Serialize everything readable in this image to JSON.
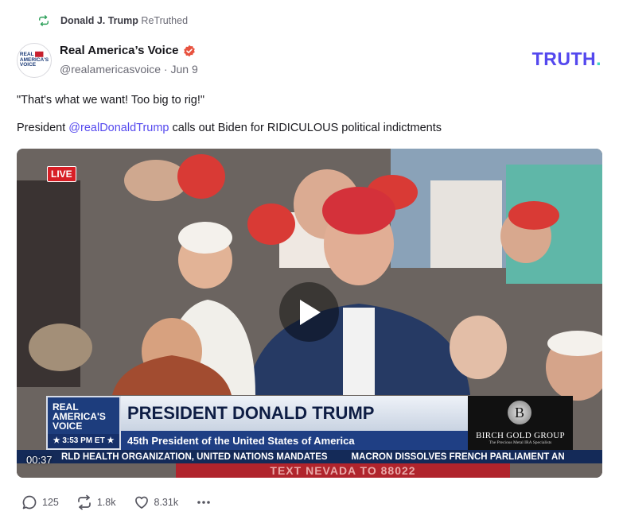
{
  "retruth": {
    "user": "Donald J. Trump",
    "label": "ReTruthed"
  },
  "author": {
    "name": "Real America’s Voice",
    "handle": "@realamericasvoice",
    "date": "Jun 9"
  },
  "brand": {
    "logo_main": "TRUTH",
    "logo_dot": "."
  },
  "post": {
    "line1": "\"That's what we want! Too big to rig!\"",
    "line2_prefix": "President ",
    "mention": "@realDonaldTrump",
    "line2_suffix": " calls out Biden for RIDICULOUS political indictments"
  },
  "video": {
    "live_badge": "LIVE",
    "duration": "00:37",
    "lower_third": {
      "channel": "REAL AMERICA'S VOICE",
      "time": "★ 3:53 PM ET ★",
      "headline": "PRESIDENT DONALD TRUMP",
      "subline": "45th President of the United States of America",
      "sponsor": "BIRCH GOLD GROUP",
      "sponsor_tag": "The Precious Metal IRA Specialists"
    },
    "ticker": [
      "RLD HEALTH ORGANIZATION, UNITED NATIONS MANDATES",
      "MACRON DISSOLVES FRENCH PARLIAMENT AN"
    ],
    "bottom_banner": "TEXT NEVADA TO 88022"
  },
  "actions": {
    "replies": "125",
    "retruths": "1.8k",
    "likes": "8.31k"
  },
  "colors": {
    "accent": "#5448ee",
    "brand_dot": "#3ed8c3",
    "retruth_green": "#2fa15b",
    "verified": "#e8523f"
  }
}
